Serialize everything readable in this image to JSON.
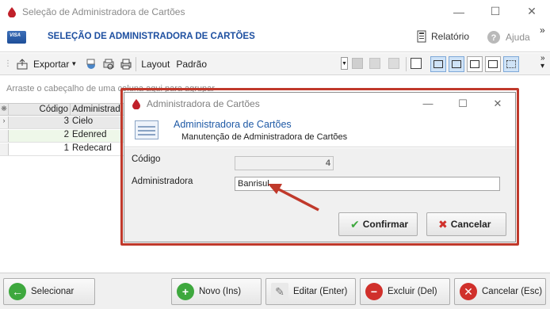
{
  "window": {
    "title": "Seleção de Administradora de Cartões",
    "minimize": "—",
    "maximize": "☐",
    "close": "✕"
  },
  "header": {
    "title": "SELEÇÃO DE ADMINISTRADORA DE CARTÕES",
    "card_text": "VISA",
    "report_label": "Relatório",
    "help_label": "Ajuda",
    "more": "»"
  },
  "toolbar": {
    "export_label": "Exportar",
    "layout_label": "Layout",
    "default_label": "Padrão"
  },
  "grid": {
    "group_hint": "Arraste o cabeçalho de uma coluna aqui para agrupar",
    "columns": [
      "Código",
      "Administrad"
    ],
    "rows": [
      {
        "code": "3",
        "name": "Cielo"
      },
      {
        "code": "2",
        "name": "Edenred"
      },
      {
        "code": "1",
        "name": "Redecard"
      }
    ]
  },
  "bottom": {
    "select_label": "Selecionar",
    "new_label": "Novo (Ins)",
    "edit_label": "Editar (Enter)",
    "delete_label": "Excluir (Del)",
    "cancel_label": "Cancelar (Esc)"
  },
  "dialog": {
    "title": "Administradora de Cartões",
    "header_title": "Administradora de Cartões",
    "header_subtitle": "Manutenção de Administradora de Cartões",
    "code_label": "Código",
    "code_value": "4",
    "admin_label": "Administradora",
    "admin_value": "Banrisul",
    "confirm_label": "Confirmar",
    "cancel_label": "Cancelar"
  },
  "colors": {
    "accent": "#1d4fa0",
    "highlight": "#c0392b",
    "green_icon": "#3ea83e",
    "red_icon": "#d0302b"
  }
}
